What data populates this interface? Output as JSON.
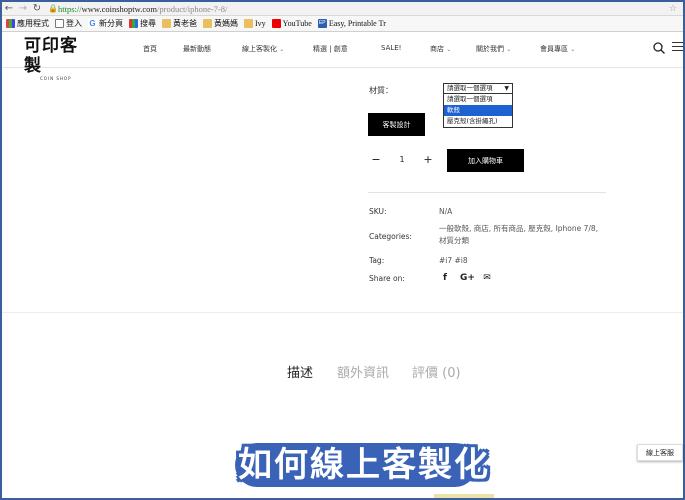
{
  "browser": {
    "url_scheme": "https://",
    "url_host": "www.coinshoptw.com",
    "url_path": "/product/iphone-7-8/",
    "bookmarks": [
      {
        "label": "應用程式",
        "icon": "apps-grid-icon"
      },
      {
        "label": "登入",
        "icon": "page-icon"
      },
      {
        "label": "新分頁",
        "icon": "google-icon"
      },
      {
        "label": "搜尋",
        "icon": "search-engine-icon"
      },
      {
        "label": "黃老爸",
        "icon": "folder-icon"
      },
      {
        "label": "黃媽媽",
        "icon": "folder-icon"
      },
      {
        "label": "Ivy",
        "icon": "folder-icon"
      },
      {
        "label": "YouTube",
        "icon": "youtube-icon"
      },
      {
        "label": "Easy, Printable Tr",
        "icon": "ep-icon"
      }
    ]
  },
  "site": {
    "logo_zh": "可印客製",
    "logo_en": "COIN SHOP",
    "nav": [
      {
        "label": "首頁",
        "has_dropdown": false
      },
      {
        "label": "最新動態",
        "has_dropdown": false
      },
      {
        "label": "線上客製化",
        "has_dropdown": true
      },
      {
        "label": "精選 | 創意",
        "has_dropdown": false
      },
      {
        "label": "SALE!",
        "has_dropdown": false
      },
      {
        "label": "商店",
        "has_dropdown": true
      },
      {
        "label": "關於我們",
        "has_dropdown": true
      },
      {
        "label": "會員專區",
        "has_dropdown": true
      }
    ]
  },
  "product": {
    "material_label": "材質：",
    "material_selected": "請選取一個選項",
    "material_options": [
      {
        "label": "請選取一個選項",
        "highlighted": false
      },
      {
        "label": "軟殼",
        "highlighted": true
      },
      {
        "label": "壓克殼(含掛繩孔)",
        "highlighted": false
      }
    ],
    "custom_design_label": "客製設計",
    "quantity": "1",
    "add_to_cart_label": "加入購物車",
    "meta": {
      "sku_label": "SKU:",
      "sku_value": "N/A",
      "categories_label": "Categories:",
      "categories_value": "一般軟殼, 商店, 所有商品, 壓克殼, Iphone 7/8, 材質分類",
      "tag_label": "Tag:",
      "tag_value": "#i7 #i8",
      "share_label": "Share on:"
    }
  },
  "tabs": [
    {
      "label": "描述",
      "active": true
    },
    {
      "label": "額外資訊",
      "active": false
    },
    {
      "label": "評價 (0)",
      "active": false
    }
  ],
  "online_service_label": "線上客服",
  "banner_text": [
    "如",
    "何",
    "線",
    "上",
    "客",
    "製",
    "化"
  ]
}
